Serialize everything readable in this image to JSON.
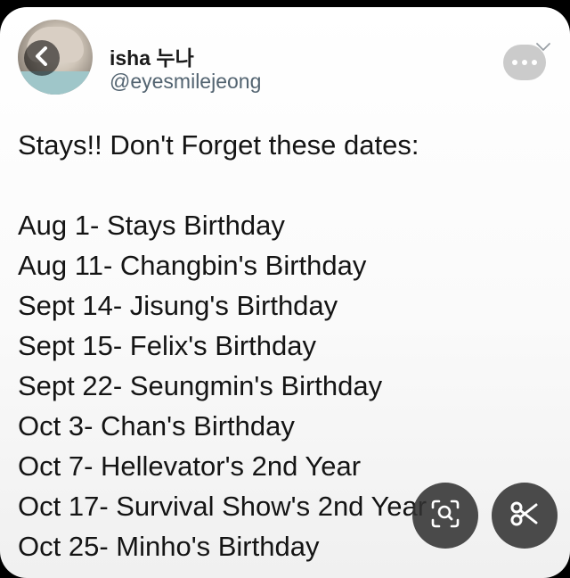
{
  "tweet": {
    "display_name": "isha 누나",
    "handle": "@eyesmilejeong",
    "heading": "Stays!! Don't Forget these dates:",
    "lines": [
      "Aug 1- Stays Birthday",
      "Aug 11- Changbin's Birthday",
      "Sept 14- Jisung's Birthday",
      "Sept 15- Felix's Birthday",
      "Sept 22- Seungmin's Birthday",
      "Oct 3- Chan's Birthday",
      "Oct 7- Hellevator's 2nd Year",
      "Oct 17- Survival Show's 2nd Year",
      "Oct 25- Minho's Birthday"
    ]
  },
  "icons": {
    "back": "chevron-left-icon",
    "dropdown": "chevron-down-icon",
    "more": "more-horizontal-icon",
    "lens": "lens-search-icon",
    "scissors": "scissors-icon"
  },
  "colors": {
    "name": "#1a1a1a",
    "handle": "#536471",
    "text": "#141414",
    "fab_bg": "#323232"
  }
}
